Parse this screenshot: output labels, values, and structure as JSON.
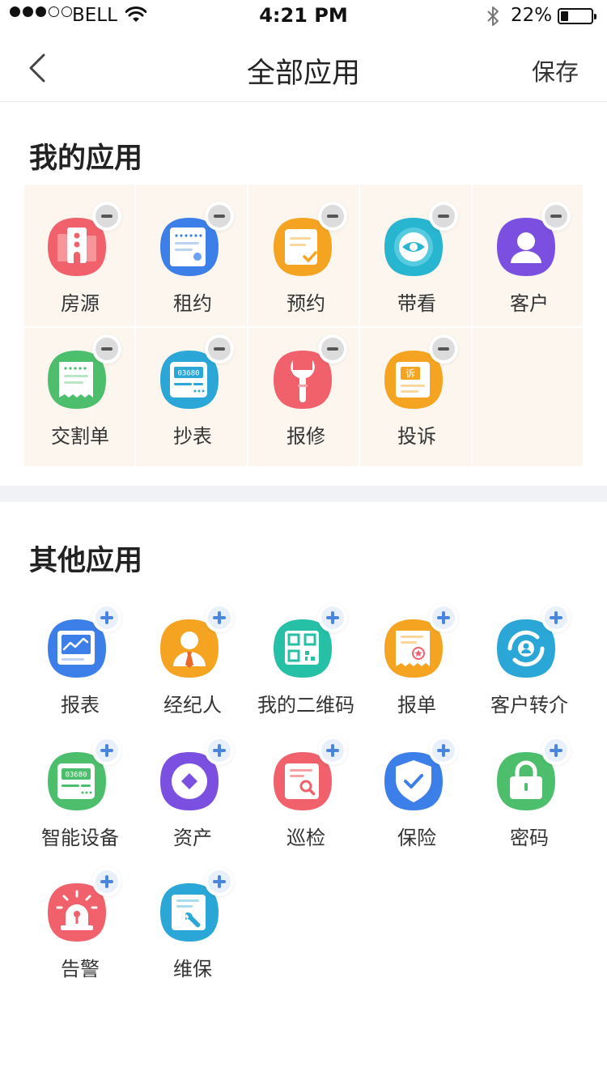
{
  "status_bar": {
    "carrier": "BELL",
    "time": "4:21 PM",
    "battery_percent": "22%",
    "battery_level": 0.22,
    "signal_bars_filled": 3,
    "signal_bars_total": 5
  },
  "nav": {
    "title": "全部应用",
    "save_label": "保存",
    "back_icon": "chevron-left-icon"
  },
  "my_apps": {
    "title": "我的应用",
    "items": [
      {
        "label": "房源",
        "icon": "house-listing-icon",
        "color": "#f0616b"
      },
      {
        "label": "租约",
        "icon": "lease-icon",
        "color": "#3d7fe8"
      },
      {
        "label": "预约",
        "icon": "appointment-icon",
        "color": "#f5a422"
      },
      {
        "label": "带看",
        "icon": "eye-icon",
        "color": "#27b5d0"
      },
      {
        "label": "客户",
        "icon": "customer-icon",
        "color": "#7b4fe0"
      },
      {
        "label": "交割单",
        "icon": "receipt-icon",
        "color": "#4cbe6c"
      },
      {
        "label": "抄表",
        "icon": "meter-reading-icon",
        "color": "#2aa7d6"
      },
      {
        "label": "报修",
        "icon": "wrench-icon",
        "color": "#f0616b"
      },
      {
        "label": "投诉",
        "icon": "complaint-icon",
        "color": "#f5a422"
      }
    ]
  },
  "other_apps": {
    "title": "其他应用",
    "items": [
      {
        "label": "报表",
        "icon": "report-chart-icon",
        "color": "#3d7fe8"
      },
      {
        "label": "经纪人",
        "icon": "agent-icon",
        "color": "#f5a422"
      },
      {
        "label": "我的二维码",
        "icon": "qr-code-icon",
        "color": "#26c0a6"
      },
      {
        "label": "报单",
        "icon": "order-certificate-icon",
        "color": "#f5a422"
      },
      {
        "label": "客户转介",
        "icon": "customer-referral-icon",
        "color": "#2aa7d6"
      },
      {
        "label": "智能设备",
        "icon": "smart-device-icon",
        "color": "#4cbe6c"
      },
      {
        "label": "资产",
        "icon": "asset-icon",
        "color": "#7b4fe0"
      },
      {
        "label": "巡检",
        "icon": "inspection-icon",
        "color": "#f0616b"
      },
      {
        "label": "保险",
        "icon": "insurance-shield-icon",
        "color": "#3d7fe8"
      },
      {
        "label": "密码",
        "icon": "lock-icon",
        "color": "#4cbe6c"
      },
      {
        "label": "告警",
        "icon": "alarm-icon",
        "color": "#f0616b"
      },
      {
        "label": "维保",
        "icon": "maintenance-icon",
        "color": "#2aa7d6"
      }
    ]
  },
  "meter_text": "03680",
  "complaint_char": "诉"
}
